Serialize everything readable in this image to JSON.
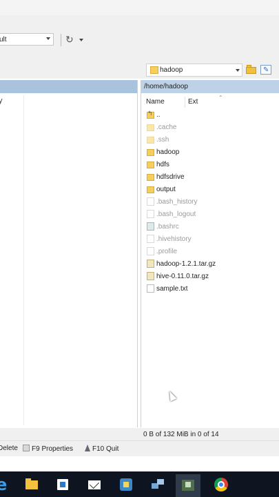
{
  "toolbar": {
    "profile_value": "ult"
  },
  "pathbar": {
    "current_folder": "hadoop"
  },
  "left_panel": {
    "fragment": "y"
  },
  "right_panel": {
    "path": "/home/hadoop",
    "columns": {
      "name": "Name",
      "ext": "Ext"
    },
    "files": [
      {
        "name": "..",
        "type": "parent"
      },
      {
        "name": ".cache",
        "type": "folder-hidden"
      },
      {
        "name": ".ssh",
        "type": "folder-hidden"
      },
      {
        "name": "hadoop",
        "type": "folder"
      },
      {
        "name": "hdfs",
        "type": "folder"
      },
      {
        "name": "hdfsdrive",
        "type": "folder"
      },
      {
        "name": "output",
        "type": "folder"
      },
      {
        "name": ".bash_history",
        "type": "file-hidden"
      },
      {
        "name": ".bash_logout",
        "type": "file-hidden"
      },
      {
        "name": ".bashrc",
        "type": "script-hidden"
      },
      {
        "name": ".hivehistory",
        "type": "file-hidden"
      },
      {
        "name": ".profile",
        "type": "file-hidden"
      },
      {
        "name": "hadoop-1.2.1.tar.gz",
        "type": "archive"
      },
      {
        "name": "hive-0.11.0.tar.gz",
        "type": "archive"
      },
      {
        "name": "sample.txt",
        "type": "file"
      }
    ],
    "status": "0 B of 132 MiB in 0 of 14"
  },
  "commands": {
    "delete": "Delete",
    "properties": "F9 Properties",
    "quit": "F10 Quit"
  },
  "taskbar": {
    "items": [
      "edge-icon",
      "file-explorer-icon",
      "store-icon",
      "mail-icon",
      "virtualbox-icon",
      "network-icon",
      "winscp-icon",
      "chrome-icon"
    ]
  }
}
